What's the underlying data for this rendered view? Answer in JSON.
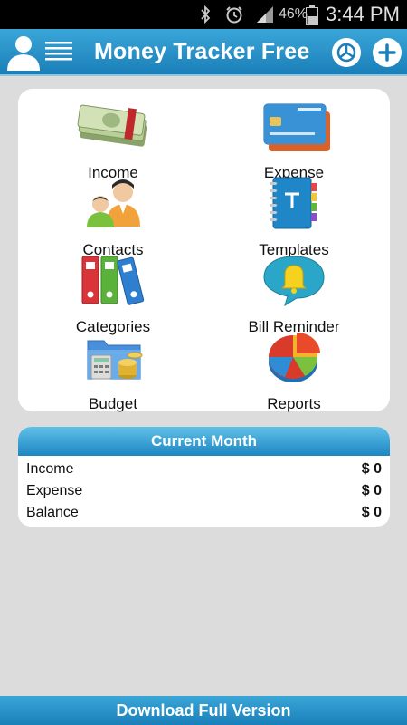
{
  "status_bar": {
    "battery": "46%",
    "time": "3:44 PM"
  },
  "header": {
    "title": "Money Tracker Free"
  },
  "menu": [
    {
      "label": "Income",
      "icon": "money-stack-icon"
    },
    {
      "label": "Expense",
      "icon": "credit-card-icon"
    },
    {
      "label": "Contacts",
      "icon": "people-icon"
    },
    {
      "label": "Templates",
      "icon": "notebook-icon"
    },
    {
      "label": "Categories",
      "icon": "binders-icon"
    },
    {
      "label": "Bill Reminder",
      "icon": "bell-icon"
    },
    {
      "label": "Budget",
      "icon": "folder-calculator-icon"
    },
    {
      "label": "Reports",
      "icon": "pie-chart-icon"
    }
  ],
  "current_month": {
    "title": "Current Month",
    "rows": [
      {
        "label": "Income",
        "value": "$ 0"
      },
      {
        "label": "Expense",
        "value": "$ 0"
      },
      {
        "label": "Balance",
        "value": "$ 0"
      }
    ]
  },
  "footer": {
    "label": "Download Full Version"
  },
  "colors": {
    "header": "#1a7fb9",
    "background": "#dcdcdc",
    "card": "#ffffff"
  }
}
